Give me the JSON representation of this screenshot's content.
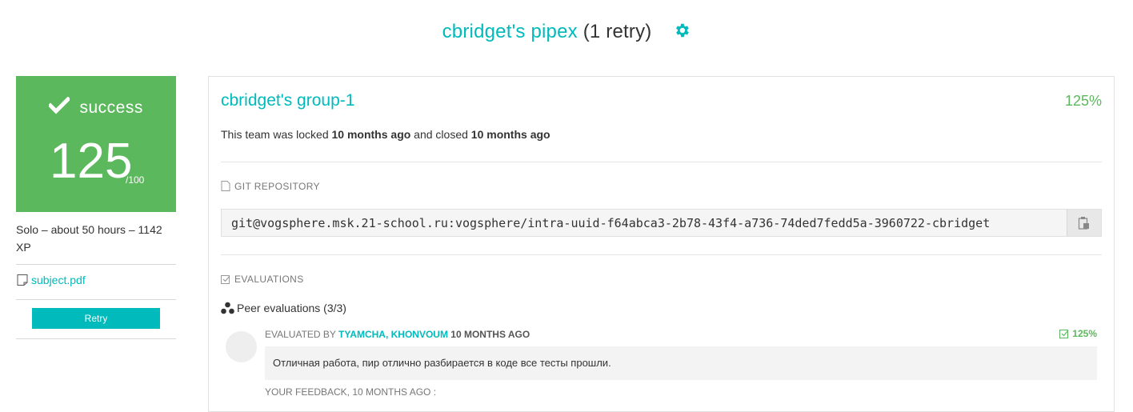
{
  "header": {
    "title_name": "cbridget's pipex",
    "retry_count": "(1 retry)",
    "settings_icon": "gear-icon"
  },
  "result": {
    "status": "success",
    "score": "125",
    "max": "/100",
    "color": "#5cb85c"
  },
  "project_meta": {
    "summary": "Solo – about 50 hours – 1142 XP",
    "subject_link": "subject.pdf",
    "retry_button": "Retry"
  },
  "team": {
    "name": "cbridget's group-1",
    "score": "125%",
    "lock_prefix": "This team was locked ",
    "locked_ago": "10 months ago",
    "lock_middle": " and closed ",
    "closed_ago": "10 months ago"
  },
  "git": {
    "section_label": "GIT REPOSITORY",
    "url": "git@vogsphere.msk.21-school.ru:vogsphere/intra-uuid-f64abca3-2b78-43f4-a736-74ded7fedd5a-3960722-cbridget"
  },
  "evaluations": {
    "section_label": "EVALUATIONS",
    "peer_title": "Peer evaluations (3/3)",
    "items": [
      {
        "evaluated_by_label": "EVALUATED BY ",
        "evaluators": "TYAMCHA, KHONVOUM",
        "ago": " 10 MONTHS AGO",
        "score": "125%",
        "comment": "Отличная работа, пир отлично разбирается в коде все тесты прошли.",
        "feedback_label": "YOUR FEEDBACK, 10 MONTHS AGO :"
      }
    ]
  },
  "colors": {
    "accent": "#00babc",
    "success": "#5cb85c"
  }
}
